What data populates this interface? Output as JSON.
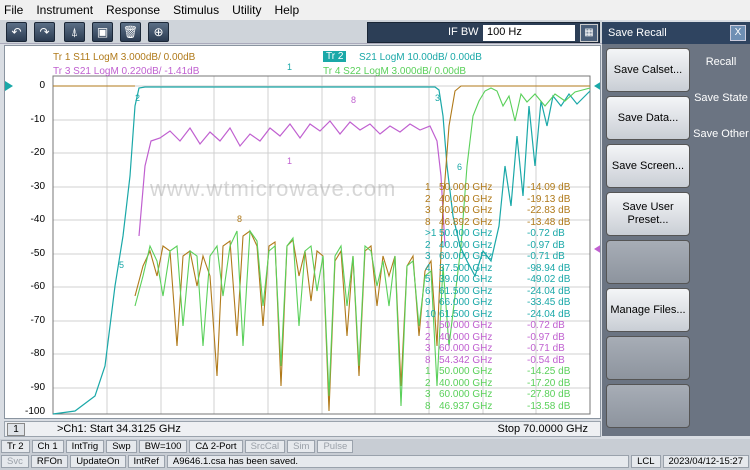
{
  "menu": [
    "File",
    "Instrument",
    "Response",
    "Stimulus",
    "Utility",
    "Help"
  ],
  "toolbar": {
    "undo": "↶",
    "redo": "↷",
    "marker": "⍋",
    "screenshot": "▣",
    "delete": "🗑",
    "zoom": "⊕"
  },
  "ifbw": {
    "label": "IF BW",
    "value": "100 Hz",
    "keypad": "▦"
  },
  "traces": {
    "tr1": "Tr  1   S11 LogM 3.000dB/  0.00dB",
    "tr2_tag": "Tr  2",
    "tr2": "S21 LogM 10.00dB/  0.00dB",
    "tr3": "Tr  3   S21 LogM 0.220dB/  -1.41dB",
    "tr4": "Tr  4   S22 LogM 3.000dB/  0.00dB"
  },
  "yaxis": [
    "0",
    "-10",
    "-20",
    "-30",
    "-40",
    "-50",
    "-60",
    "-70",
    "-80",
    "-90",
    "-100"
  ],
  "watermark": "www.wtmicrowave.com",
  "markers": [
    {
      "id": "1",
      "freq": "50.000  GHz",
      "val": "-14.09 dB",
      "color": "#b07a1a"
    },
    {
      "id": "2",
      "freq": "40.000  GHz",
      "val": "-19.13 dB",
      "color": "#b07a1a"
    },
    {
      "id": "3",
      "freq": "60.000  GHz",
      "val": "-22.83 dB",
      "color": "#b07a1a"
    },
    {
      "id": "8",
      "freq": "46.892  GHz",
      "val": "-13.48 dB",
      "color": "#b07a1a"
    },
    {
      "id": ">1",
      "freq": "50.000  GHz",
      "val": "-0.72 dB",
      "color": "#1aa8a8"
    },
    {
      "id": "2",
      "freq": "40.000  GHz",
      "val": "-0.97 dB",
      "color": "#1aa8a8"
    },
    {
      "id": "3",
      "freq": "60.000  GHz",
      "val": "-0.71 dB",
      "color": "#1aa8a8"
    },
    {
      "id": "4",
      "freq": "37.500  GHz",
      "val": "-98.94 dB",
      "color": "#1aa8a8"
    },
    {
      "id": "5",
      "freq": "39.000  GHz",
      "val": "-49.02 dB",
      "color": "#1aa8a8"
    },
    {
      "id": "6",
      "freq": "61.500  GHz",
      "val": "-24.04 dB",
      "color": "#1aa8a8"
    },
    {
      "id": "9",
      "freq": "66.000  GHz",
      "val": "-33.45 dB",
      "color": "#1aa8a8"
    },
    {
      "id": "10",
      "freq": "61.500  GHz",
      "val": "-24.04 dB",
      "color": "#1aa8a8"
    },
    {
      "id": "1",
      "freq": "50.000  GHz",
      "val": "-0.72 dB",
      "color": "#c060d0"
    },
    {
      "id": "2",
      "freq": "40.000  GHz",
      "val": "-0.97 dB",
      "color": "#c060d0"
    },
    {
      "id": "3",
      "freq": "60.000  GHz",
      "val": "-0.71 dB",
      "color": "#c060d0"
    },
    {
      "id": "8",
      "freq": "54.342  GHz",
      "val": "-0.54 dB",
      "color": "#c060d0"
    },
    {
      "id": "1",
      "freq": "50.000  GHz",
      "val": "-14.25 dB",
      "color": "#5ad05a"
    },
    {
      "id": "2",
      "freq": "40.000  GHz",
      "val": "-17.20 dB",
      "color": "#5ad05a"
    },
    {
      "id": "3",
      "freq": "60.000  GHz",
      "val": "-27.80 dB",
      "color": "#5ad05a"
    },
    {
      "id": "8",
      "freq": "46.937  GHz",
      "val": "-13.58 dB",
      "color": "#5ad05a"
    }
  ],
  "bottom": {
    "ch": "1",
    "start": ">Ch1:  Start  34.3125 GHz",
    "stop": "Stop  70.0000 GHz"
  },
  "status1": [
    {
      "t": "Tr 2",
      "dim": false
    },
    {
      "t": "Ch 1",
      "dim": false
    },
    {
      "t": "IntTrig",
      "dim": false
    },
    {
      "t": "Swp",
      "dim": false
    },
    {
      "t": "BW=100",
      "dim": false
    },
    {
      "t": "C∆ 2-Port",
      "dim": false
    },
    {
      "t": "SrcCal",
      "dim": true
    },
    {
      "t": "Sim",
      "dim": true
    },
    {
      "t": "Pulse",
      "dim": true
    }
  ],
  "status2": [
    {
      "t": "Svc",
      "dim": true
    },
    {
      "t": "RFOn",
      "dim": false
    },
    {
      "t": "UpdateOn",
      "dim": false
    },
    {
      "t": "IntRef",
      "dim": false
    }
  ],
  "message": "A9646.1.csa has been saved.",
  "lcl": "LCL",
  "datetime": "2023/04/12-15:27",
  "side": {
    "title": "Save Recall",
    "close": "X",
    "keys": [
      "Save Calset...",
      "Save Data...",
      "Save Screen...",
      "Save User Preset...",
      "",
      "Manage Files...",
      "",
      ""
    ],
    "tabs": [
      "Recall",
      "Save State",
      "Save Other"
    ]
  }
}
